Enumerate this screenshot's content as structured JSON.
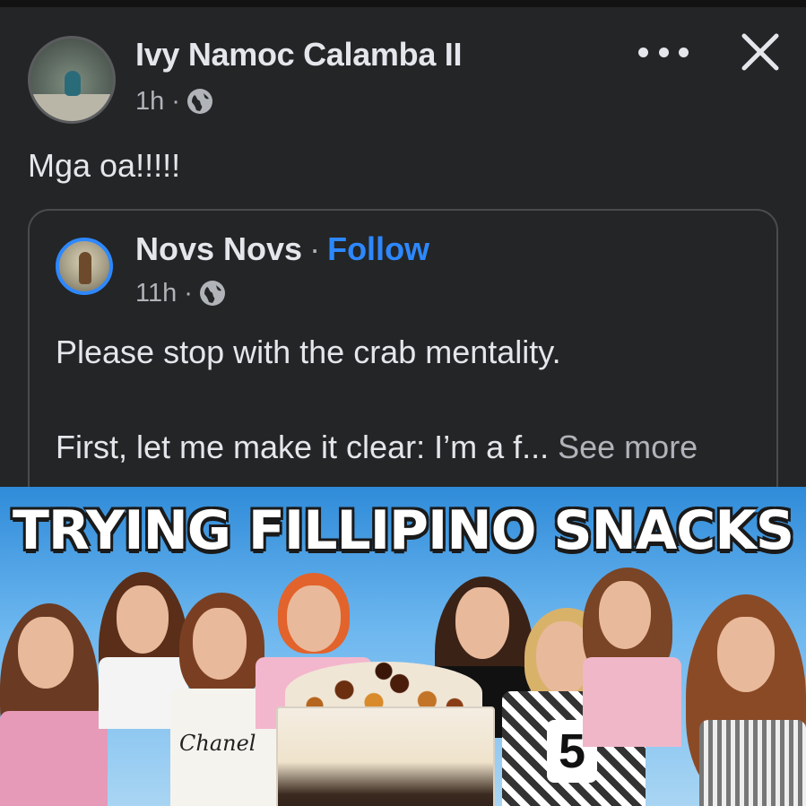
{
  "post": {
    "author": "Ivy Namoc Calamba II",
    "time": "1h",
    "dot": "·",
    "text": "Mga oa!!!!!"
  },
  "shared": {
    "author": "Novs Novs",
    "separator": "·",
    "follow_label": "Follow",
    "time": "11h",
    "dot": "·",
    "line1": "Please stop with the crab mentality.",
    "line2": "First, let me make it clear: I’m a f...",
    "see_more": "See more"
  },
  "thumbnail": {
    "title": "TRYING FILLIPINO SNACKS",
    "shirt_text": "Chanel",
    "shirt_number": "5"
  },
  "icons": {
    "header_privacy": "globe-icon",
    "shared_privacy": "globe-icon",
    "more": "more-options-icon",
    "close": "close-icon"
  },
  "colors": {
    "background": "#242526",
    "text_primary": "#e4e6eb",
    "text_secondary": "#b0b3b8",
    "accent": "#2d88ff"
  }
}
